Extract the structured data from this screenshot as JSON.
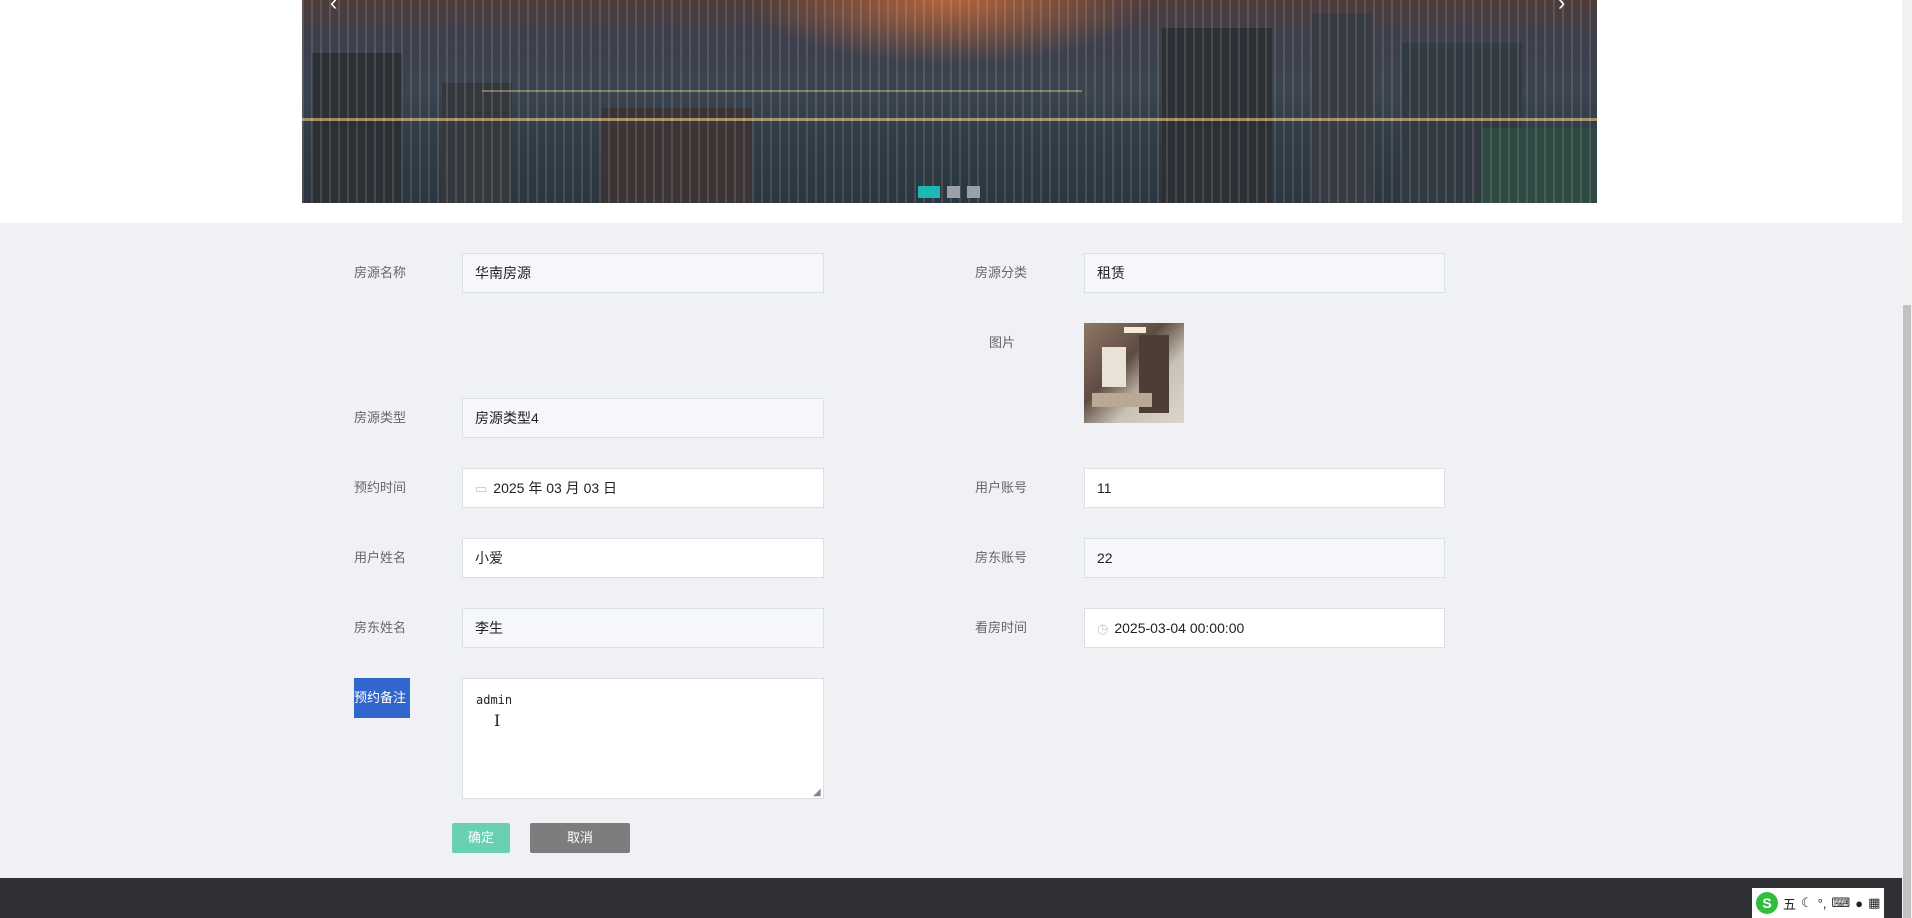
{
  "banner": {
    "prev_arrow": "‹",
    "next_arrow": "›",
    "slides": 3,
    "active_slide": 1
  },
  "form": {
    "fangyuan_mingcheng": {
      "label": "房源名称",
      "value": "华南房源"
    },
    "fangyuan_fenlei": {
      "label": "房源分类",
      "value": "租赁"
    },
    "tupian": {
      "label": "图片"
    },
    "fangyuan_leixing": {
      "label": "房源类型",
      "value": "房源类型4"
    },
    "yuyue_shijian": {
      "label": "预约时间",
      "value": "2025 年 03 月 03 日"
    },
    "yonghu_zhanghao": {
      "label": "用户账号",
      "value": "11"
    },
    "yonghu_xingming": {
      "label": "用户姓名",
      "value": "小爱"
    },
    "fangdong_zhanghao": {
      "label": "房东账号",
      "value": "22"
    },
    "fangdong_xingming": {
      "label": "房东姓名",
      "value": "李生"
    },
    "kanfang_shijian": {
      "label": "看房时间",
      "value": "2025-03-04 00:00:00"
    },
    "yuyue_beizhu": {
      "label": "预约备注",
      "value": "admin"
    }
  },
  "buttons": {
    "confirm": "确定",
    "cancel": "取消"
  },
  "tray": {
    "ime_logo": "S",
    "ime_mode": "五",
    "icons": [
      "moon-icon",
      "punctuation-icon",
      "keyboard-icon",
      "user-icon",
      "grid-icon"
    ]
  },
  "colors": {
    "accent": "#1fb6b6",
    "confirm_button": "#69d0b4",
    "cancel_button": "#7d7d7d",
    "selected_label": "#3166cc",
    "footer": "#2f3134"
  }
}
